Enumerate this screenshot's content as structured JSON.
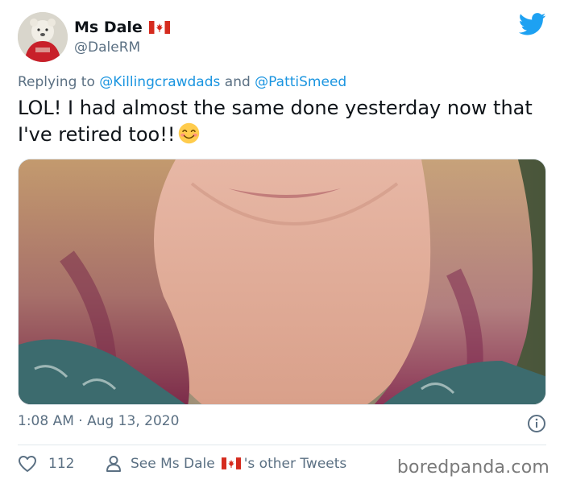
{
  "author": {
    "display_name": "Ms Dale",
    "handle": "@DaleRM"
  },
  "reply": {
    "prefix": "Replying to",
    "mention_1": "@Killingcrawdads",
    "conjunction": "and",
    "mention_2": "@PattiSmeed"
  },
  "tweet": {
    "text": "LOL! I had almost the same done yesterday now that I've retired too!!",
    "emoji": "smiling-face-with-smiling-eyes"
  },
  "meta": {
    "timestamp": "1:08 AM · Aug 13, 2020"
  },
  "actions": {
    "like_count": "112",
    "see_prefix": "See Ms Dale",
    "see_suffix": "'s other Tweets"
  },
  "watermark": "boredpanda.com",
  "colors": {
    "twitter_blue": "#1da1f2",
    "link_blue": "#1b95e0",
    "muted_gray": "#5b7083",
    "canada_red": "#d52b1e"
  }
}
